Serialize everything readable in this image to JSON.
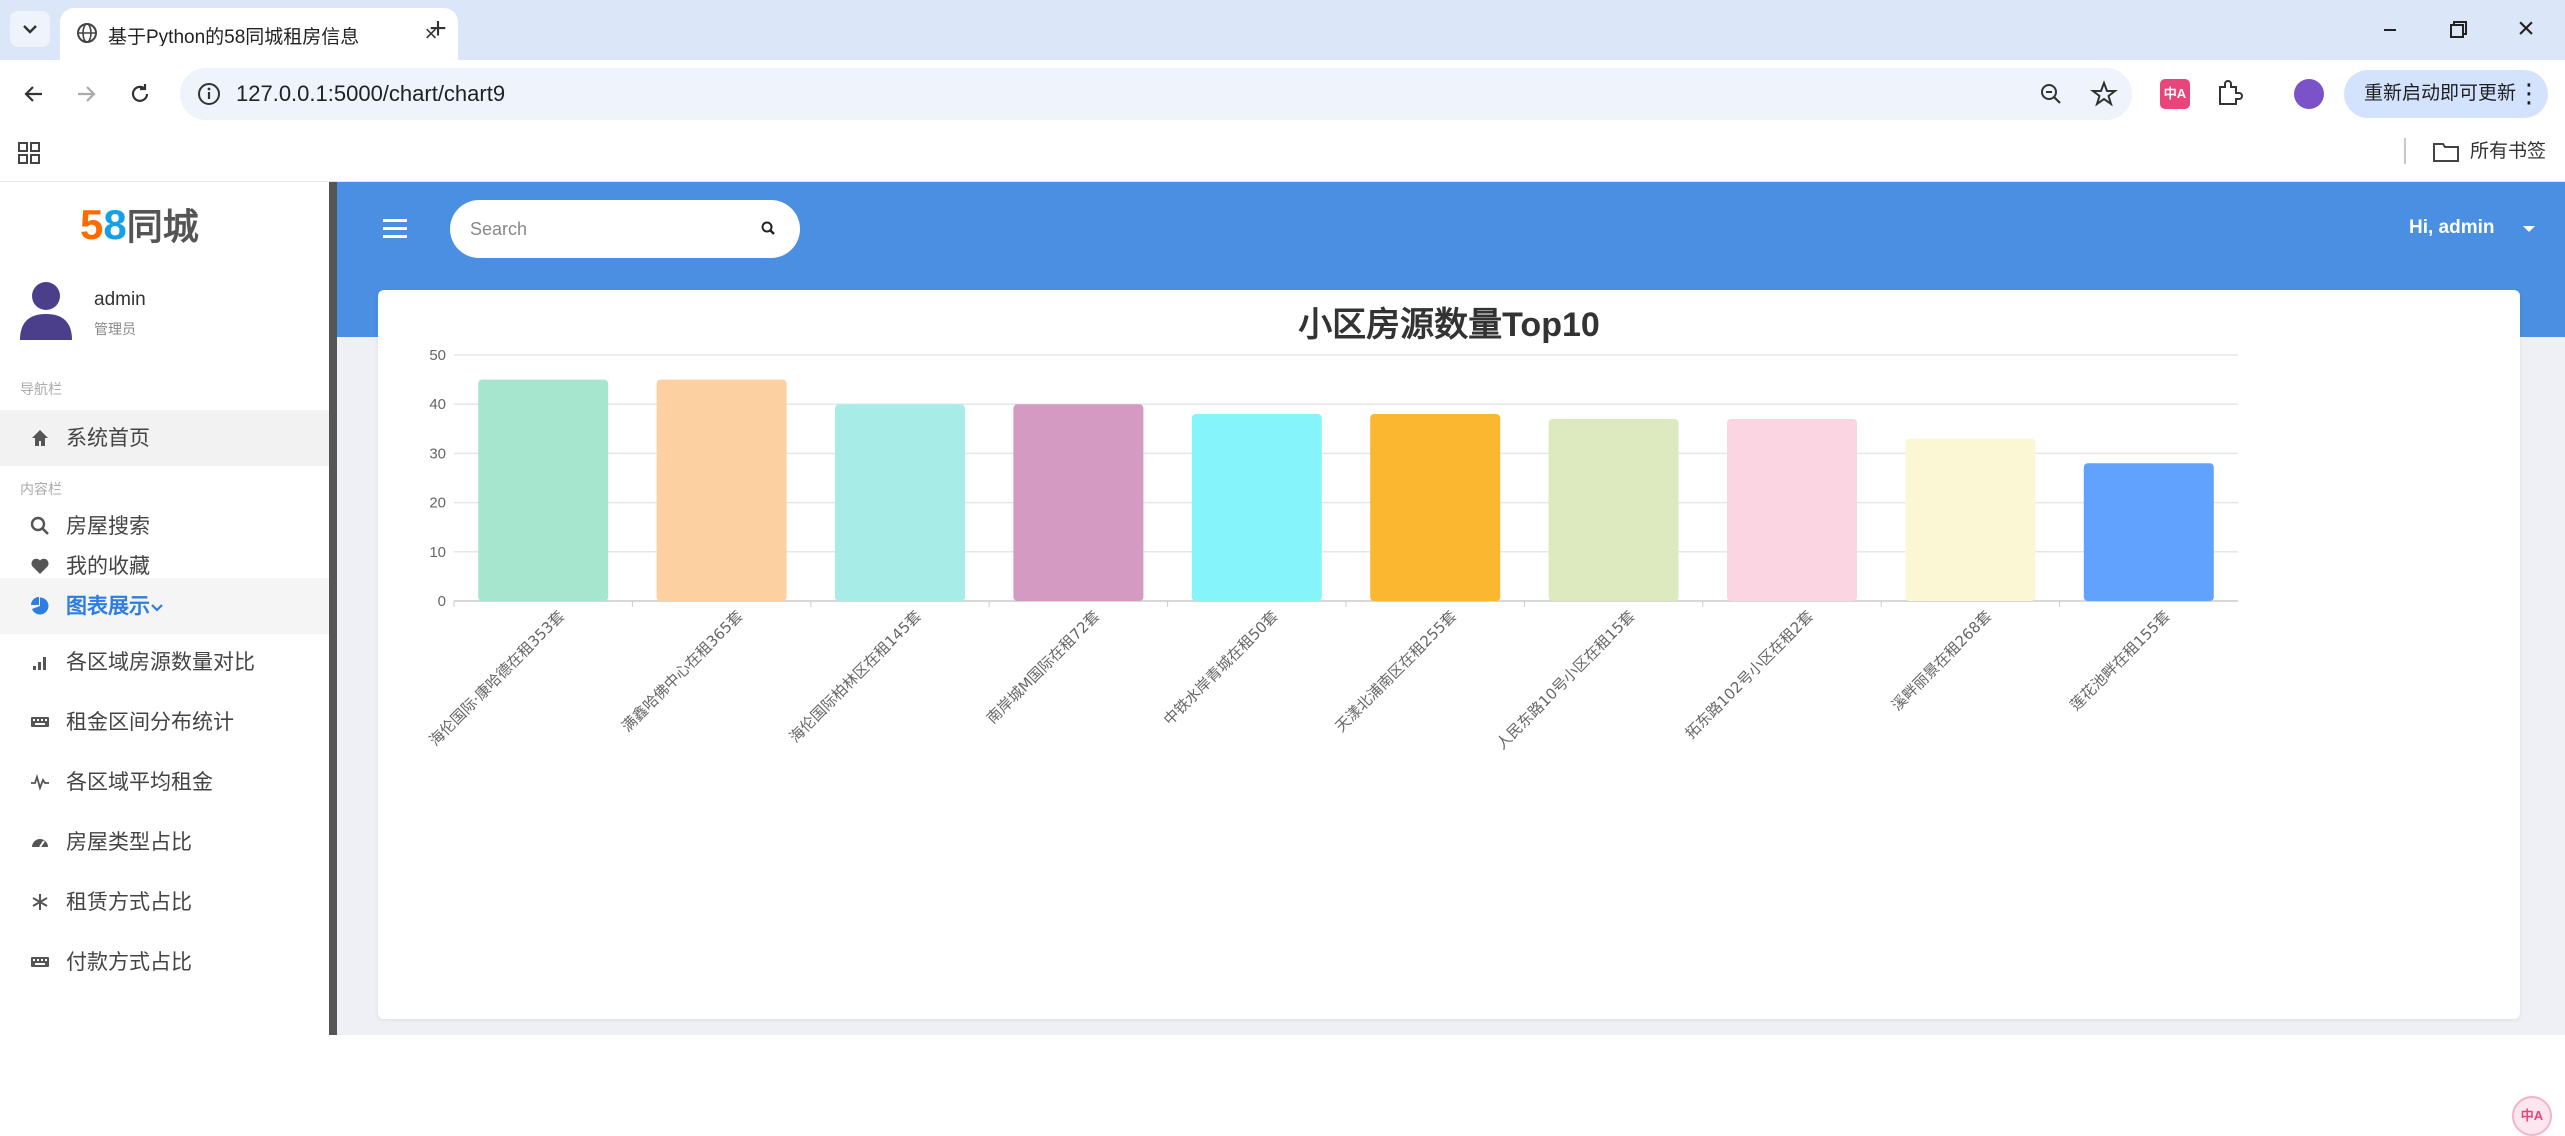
{
  "browser": {
    "tab_title": "基于Python的58同城租房信息",
    "url": "127.0.0.1:5000/chart/chart9",
    "update_button_label": "重新启动即可更新",
    "bookmarks_all_label": "所有书签",
    "translate_ext_label": "中A"
  },
  "sidebar": {
    "logo_digits": [
      "5",
      "8"
    ],
    "logo_text": "同城",
    "user_name": "admin",
    "user_role": "管理员",
    "section_nav": "导航栏",
    "section_content": "内容栏",
    "items": [
      {
        "label": "系统首页",
        "icon": "home-icon"
      },
      {
        "label": "房屋搜索",
        "icon": "search-icon"
      },
      {
        "label": "我的收藏",
        "icon": "heart-icon"
      },
      {
        "label": "图表展示",
        "icon": "pie-chart-icon",
        "active": true
      },
      {
        "label": "各区域房源数量对比",
        "icon": "signal-bars-icon"
      },
      {
        "label": "租金区间分布统计",
        "icon": "keyboard-icon"
      },
      {
        "label": "各区域平均租金",
        "icon": "pulse-icon"
      },
      {
        "label": "房屋类型占比",
        "icon": "dashboard-icon"
      },
      {
        "label": "租赁方式占比",
        "icon": "asterisk-icon"
      },
      {
        "label": "付款方式占比",
        "icon": "keyboard-icon"
      }
    ]
  },
  "header": {
    "search_placeholder": "Search",
    "greeting": "Hi, admin",
    "accent_color": "#4a8fe2"
  },
  "chart_data": {
    "type": "bar",
    "title": "小区房源数量Top10",
    "ylim": [
      0,
      50
    ],
    "yticks": [
      0,
      10,
      20,
      30,
      40,
      50
    ],
    "grid": true,
    "categories": [
      "海伦国际·康哈德在租353套",
      "满鑫哈佛中心在租365套",
      "海伦国际柏林区在租145套",
      "南岸城M国际在租72套",
      "中铁水岸青城在租50套",
      "天漾北浦南区在租255套",
      "人民东路10号小区在租15套",
      "拓东路102号小区在租2套",
      "溪畔丽景在租268套",
      "莲花池畔在租155套"
    ],
    "values": [
      45,
      45,
      40,
      40,
      38,
      38,
      37,
      37,
      33,
      28
    ],
    "colors": [
      "#a6e6cf",
      "#fdd0a2",
      "#a8ece7",
      "#d49ac2",
      "#86f5fb",
      "#fbb72f",
      "#ddeabf",
      "#fcd5e2",
      "#fbf7d5",
      "#61a2ff"
    ]
  }
}
